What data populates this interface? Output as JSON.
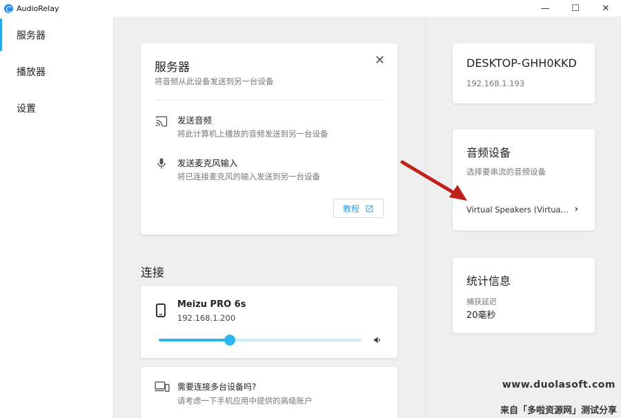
{
  "window": {
    "title": "AudioRelay",
    "controls": {
      "minimize": "—",
      "maximize": "☐",
      "close": "✕"
    }
  },
  "sidebar": {
    "items": [
      {
        "label": "服务器",
        "active": true
      },
      {
        "label": "播放器",
        "active": false
      },
      {
        "label": "设置",
        "active": false
      }
    ]
  },
  "server_card": {
    "title": "服务器",
    "subtitle": "将音频从此设备发送到另一台设备",
    "options": [
      {
        "title": "发送音频",
        "description": "将此计算机上播放的音频发送到另一台设备",
        "icon": "cast-icon"
      },
      {
        "title": "发送麦克风输入",
        "description": "将已连接麦克风的输入发送到另一台设备",
        "icon": "microphone-icon"
      }
    ],
    "tutorial_label": "教程"
  },
  "connections": {
    "heading": "连接",
    "device": {
      "name": "Meizu PRO 6s",
      "ip": "192.168.1.200",
      "volume_percent": 35
    }
  },
  "multi_device": {
    "title": "需要连接多台设备吗?",
    "description": "请考虑一下手机应用中提供的高级账户"
  },
  "host": {
    "name": "DESKTOP-GHH0KKD",
    "ip": "192.168.1.193"
  },
  "audio_device": {
    "title": "音频设备",
    "subtitle": "选择要串流的音频设备",
    "selected": "Virtual Speakers (Virtua…"
  },
  "stats": {
    "title": "统计信息",
    "latency_label": "捕获延迟",
    "latency_value": "20毫秒"
  },
  "watermark": {
    "site": "www.duolasoft.com",
    "note": "来自「多啦资源网」测试分享"
  },
  "colors": {
    "accent": "#2db7ee",
    "active_nav": "#29a9e8",
    "annotation_arrow": "#c0201c"
  }
}
